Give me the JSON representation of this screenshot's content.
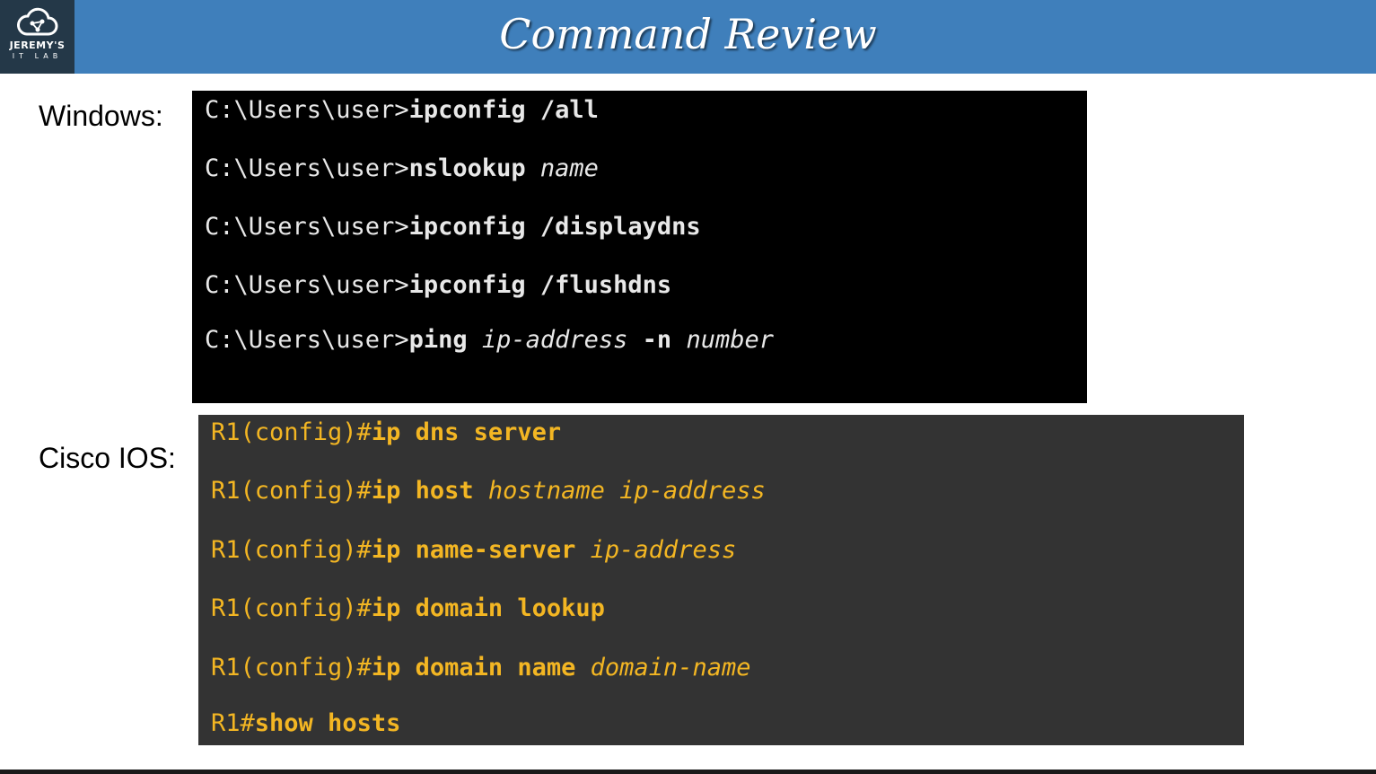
{
  "header": {
    "title": "Command Review",
    "background_color": "#3f7fbb",
    "logo": {
      "icon": "cloud-network-icon",
      "line1": "JEREMY'S",
      "line2": "IT LAB"
    }
  },
  "windows": {
    "label": "Windows:",
    "background_color": "#000000",
    "text_color": "#e8e8e8",
    "commands": [
      {
        "prompt": "C:\\Users\\user>",
        "command": "ipconfig /all",
        "argument": ""
      },
      {
        "prompt": "C:\\Users\\user>",
        "command": "nslookup ",
        "argument": "name"
      },
      {
        "prompt": "C:\\Users\\user>",
        "command": "ipconfig /displaydns",
        "argument": ""
      },
      {
        "prompt": "C:\\Users\\user>",
        "command": "ipconfig /flushdns",
        "argument": ""
      },
      {
        "prompt": "C:\\Users\\user>",
        "command": "ping ",
        "argument": "ip-address",
        "command2": " -n ",
        "argument2": "number"
      }
    ]
  },
  "cisco": {
    "label": "Cisco IOS:",
    "background_color": "#333333",
    "text_color": "#f3b623",
    "commands": [
      {
        "prompt": "R1(config)#",
        "command": "ip dns server",
        "argument": ""
      },
      {
        "prompt": "R1(config)#",
        "command": "ip host ",
        "argument": "hostname ip-address"
      },
      {
        "prompt": "R1(config)#",
        "command": "ip name-server ",
        "argument": "ip-address"
      },
      {
        "prompt": "R1(config)#",
        "command": "ip domain lookup",
        "argument": ""
      },
      {
        "prompt": "R1(config)#",
        "command": "ip domain name ",
        "argument": "domain-name"
      },
      {
        "prompt": "R1#",
        "command": "show hosts",
        "argument": ""
      }
    ]
  }
}
